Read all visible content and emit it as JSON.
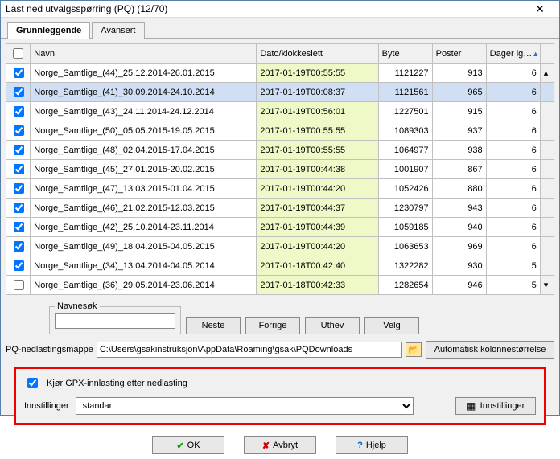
{
  "window": {
    "title": "Last ned utvalgsspørring (PQ)   (12/70)"
  },
  "tabs": {
    "basic": "Grunnleggende",
    "advanced": "Avansert"
  },
  "headers": {
    "name": "Navn",
    "date": "Dato/klokkeslett",
    "byte": "Byte",
    "posts": "Poster",
    "days": "Dager ig…"
  },
  "rows": [
    {
      "name": "Norge_Samtlige_(44)_25.12.2014-26.01.2015",
      "date": "2017-01-19T00:55:55",
      "byte": "1121227",
      "posts": "913",
      "days": "6",
      "hl": true
    },
    {
      "name": "Norge_Samtlige_(41)_30.09.2014-24.10.2014",
      "date": "2017-01-19T00:08:37",
      "byte": "1121561",
      "posts": "965",
      "days": "6",
      "hl": false,
      "selected": true
    },
    {
      "name": "Norge_Samtlige_(43)_24.11.2014-24.12.2014",
      "date": "2017-01-19T00:56:01",
      "byte": "1227501",
      "posts": "915",
      "days": "6",
      "hl": true
    },
    {
      "name": "Norge_Samtlige_(50)_05.05.2015-19.05.2015",
      "date": "2017-01-19T00:55:55",
      "byte": "1089303",
      "posts": "937",
      "days": "6",
      "hl": true
    },
    {
      "name": "Norge_Samtlige_(48)_02.04.2015-17.04.2015",
      "date": "2017-01-19T00:55:55",
      "byte": "1064977",
      "posts": "938",
      "days": "6",
      "hl": true
    },
    {
      "name": "Norge_Samtlige_(45)_27.01.2015-20.02.2015",
      "date": "2017-01-19T00:44:38",
      "byte": "1001907",
      "posts": "867",
      "days": "6",
      "hl": true
    },
    {
      "name": "Norge_Samtlige_(47)_13.03.2015-01.04.2015",
      "date": "2017-01-19T00:44:20",
      "byte": "1052426",
      "posts": "880",
      "days": "6",
      "hl": true
    },
    {
      "name": "Norge_Samtlige_(46)_21.02.2015-12.03.2015",
      "date": "2017-01-19T00:44:37",
      "byte": "1230797",
      "posts": "943",
      "days": "6",
      "hl": true
    },
    {
      "name": "Norge_Samtlige_(42)_25.10.2014-23.11.2014",
      "date": "2017-01-19T00:44:39",
      "byte": "1059185",
      "posts": "940",
      "days": "6",
      "hl": true
    },
    {
      "name": "Norge_Samtlige_(49)_18.04.2015-04.05.2015",
      "date": "2017-01-19T00:44:20",
      "byte": "1063653",
      "posts": "969",
      "days": "6",
      "hl": true
    },
    {
      "name": "Norge_Samtlige_(34)_13.04.2014-04.05.2014",
      "date": "2017-01-18T00:42:40",
      "byte": "1322282",
      "posts": "930",
      "days": "5",
      "hl": true
    },
    {
      "name": "Norge_Samtlige_(36)_29.05.2014-23.06.2014",
      "date": "2017-01-18T00:42:33",
      "byte": "1282654",
      "posts": "946",
      "days": "5",
      "hl": true
    }
  ],
  "search": {
    "label": "Navnesøk",
    "next": "Neste",
    "prev": "Forrige",
    "highlight": "Uthev",
    "select": "Velg"
  },
  "pathrow": {
    "label": "PQ-nedlastingsmappe",
    "value": "C:\\Users\\gsakinstruksjon\\AppData\\Roaming\\gsak\\PQDownloads",
    "autobtn": "Automatisk kolonnestørrelse"
  },
  "gpx": {
    "checkbox": "Kjør GPX-innlasting etter nedlasting",
    "settingsLabel": "Innstillinger",
    "selectValue": "standar",
    "settingsBtn": "Innstillinger"
  },
  "buttons": {
    "ok": "OK",
    "cancel": "Avbryt",
    "help": "Hjelp"
  }
}
